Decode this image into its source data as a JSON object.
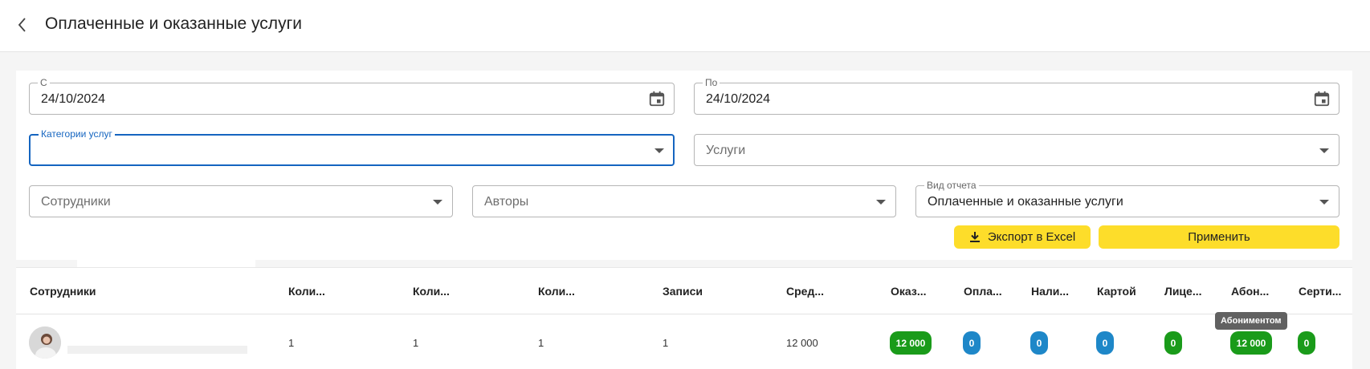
{
  "header": {
    "title": "Оплаченные и оказанные услуги"
  },
  "filters": {
    "date_from": {
      "label": "С",
      "value": "24/10/2024"
    },
    "date_to": {
      "label": "По",
      "value": "24/10/2024"
    },
    "categories": {
      "label": "Категории услуг",
      "value": ""
    },
    "services": {
      "placeholder": "Услуги"
    },
    "employees": {
      "placeholder": "Сотрудники"
    },
    "authors": {
      "placeholder": "Авторы"
    },
    "report_type": {
      "label": "Вид отчета",
      "value": "Оплаченные и оказанные услуги"
    },
    "export_label": "Экспорт в Excel",
    "apply_label": "Применить"
  },
  "table": {
    "columns": [
      "Сотрудники",
      "Коли...",
      "Коли...",
      "Коли...",
      "Записи",
      "Сред...",
      "Оказ...",
      "Опла...",
      "Нали...",
      "Картой",
      "Лице...",
      "Абон...",
      "Серти..."
    ],
    "row": {
      "c1": "1",
      "c2": "1",
      "c3": "1",
      "c4": "1",
      "avg": "12 000",
      "b_done": "12 000",
      "b_paid": "0",
      "b_cash": "0",
      "b_card": "0",
      "b_personal": "0",
      "b_subscription": "12 000",
      "b_cert": "0"
    },
    "tooltip": "Абониментом"
  },
  "colors": {
    "accent_yellow": "#fddd2a",
    "focus_blue": "#1565c0",
    "badge_green": "#1a9b1a",
    "badge_blue": "#1e87c8"
  }
}
